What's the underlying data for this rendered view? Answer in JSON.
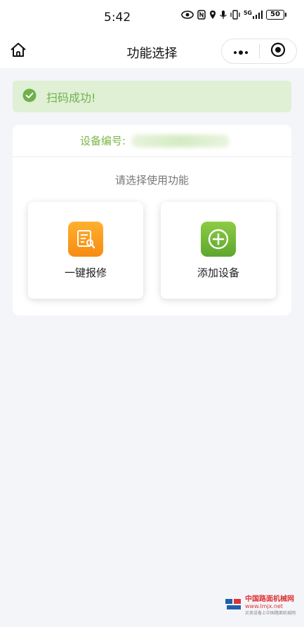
{
  "status_bar": {
    "time": "5:42",
    "network": "5G",
    "battery": "50"
  },
  "nav": {
    "title": "功能选择"
  },
  "banner": {
    "text": "扫码成功!"
  },
  "device": {
    "label": "设备编号:",
    "value": ""
  },
  "prompt": "请选择使用功能",
  "functions": [
    {
      "label": "一键报修",
      "icon": "repair-form-icon",
      "color": "#f99418"
    },
    {
      "label": "添加设备",
      "icon": "plus-circle-icon",
      "color": "#6fb136"
    }
  ],
  "watermark": {
    "line1": "中国路面机械网",
    "line2": "www.lmjx.net",
    "line3": "买卖设备上中国路面机械网"
  },
  "colors": {
    "accent_green": "#7ab544",
    "banner_bg": "#dff0d4",
    "page_bg": "#f4f5f9"
  }
}
